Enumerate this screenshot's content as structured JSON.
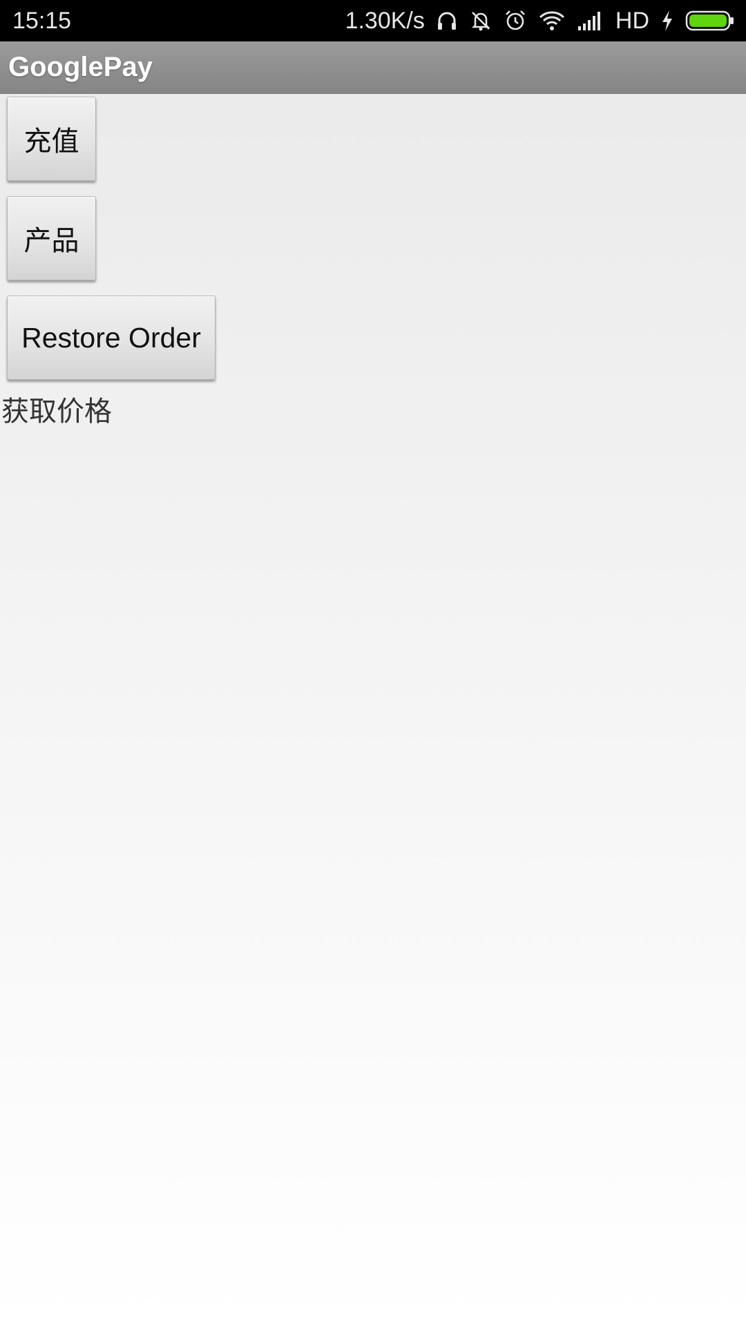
{
  "status_bar": {
    "time": "15:15",
    "network_speed": "1.30K/s",
    "network_type": "HD",
    "icons": [
      "headset-icon",
      "mute-icon",
      "alarm-icon",
      "wifi-icon",
      "signal-icon",
      "charging-icon",
      "battery-icon"
    ],
    "battery_color": "#5fd40f"
  },
  "app_bar": {
    "title": "GooglePay"
  },
  "buttons": {
    "recharge": "充值",
    "product": "产品",
    "restore": "Restore Order"
  },
  "price_label": "获取价格"
}
